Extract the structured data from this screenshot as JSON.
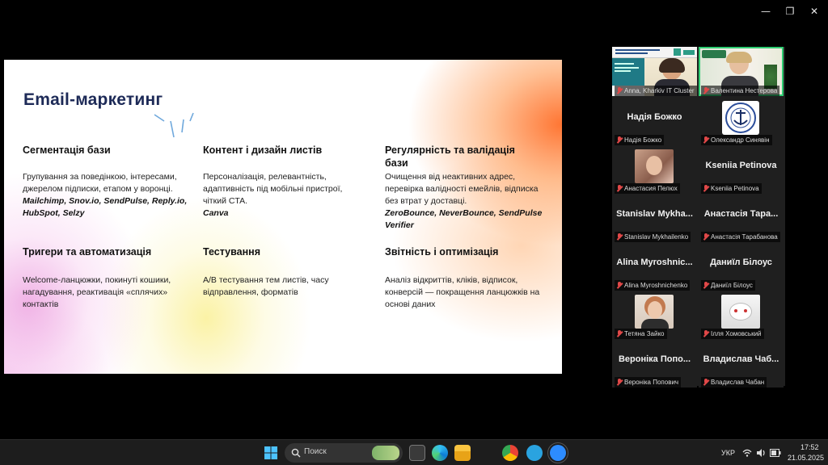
{
  "window": {
    "controls": {
      "minimize": "—",
      "restore": "❐",
      "close": "✕"
    }
  },
  "slide": {
    "title": "Email-маркетинг",
    "blocks": [
      {
        "title": "Сегментація бази",
        "body": "Групування за поведінкою, інтересами, джерелом підписки, етапом у воронці.",
        "tools": "Mailchimp, Snov.io, SendPulse, Reply.io, HubSpot, Selzy"
      },
      {
        "title": "Контент і дизайн листів",
        "body": "Персоналізація, релевантність, адаптивність під мобільні пристрої, чіткий CTA.",
        "tools": "Canva"
      },
      {
        "title": "Регулярність та валідація бази",
        "body": "Очищення від неактивних адрес, перевірка валідності емейлів, відписка без втрат у доставці.",
        "tools": "ZeroBounce, NeverBounce, SendPulse Verifier"
      },
      {
        "title": "Тригери та автоматизація",
        "body": "Welcome-ланцюжки, покинуті кошики, нагадування, реактивація «сплячих» контактів",
        "tools": ""
      },
      {
        "title": "Тестування",
        "body": "A/B тестування тем листів, часу відправлення, форматів",
        "tools": ""
      },
      {
        "title": "Звітність і оптимізація",
        "body": "Аналіз відкриттів, кліків, відписок, конверсій — покращення ланцюжків на основі даних",
        "tools": ""
      }
    ]
  },
  "participants": {
    "video": [
      {
        "label": "Anna, Kharkiv IT Cluster"
      },
      {
        "label": "Валентина Нестерова"
      }
    ],
    "tiles": [
      {
        "name": "Надія Божко",
        "label": "Надія Божко",
        "kind": "name"
      },
      {
        "name": "",
        "label": "Олександр Синявін",
        "kind": "logo"
      },
      {
        "name": "",
        "label": "Анастасия Пелюх",
        "kind": "photo"
      },
      {
        "name": "Kseniia Petinova",
        "label": "Kseniia Petinova",
        "kind": "name"
      },
      {
        "name": "Stanislav Mykha...",
        "label": "Stanislav Mykhailenko",
        "kind": "name"
      },
      {
        "name": "Анастасія Тара...",
        "label": "Анастасія Тарабанова",
        "kind": "name"
      },
      {
        "name": "Alina Myroshnic...",
        "label": "Alina Myroshnichenko",
        "kind": "name"
      },
      {
        "name": "Даниїл Білоус",
        "label": "Даниїл Білоус",
        "kind": "name"
      },
      {
        "name": "",
        "label": "Тетяна Зайко",
        "kind": "photo"
      },
      {
        "name": "",
        "label": "Ілля Хомовський",
        "kind": "photo"
      },
      {
        "name": "Вероніка Попо...",
        "label": "Вероніка Попович",
        "kind": "name"
      },
      {
        "name": "Владислав Чаб...",
        "label": "Владислав Чабан",
        "kind": "name"
      }
    ]
  },
  "taskbar": {
    "search_placeholder": "Поиск",
    "language": "УКР",
    "time": "17:52",
    "date": "21.05.2025",
    "icons": [
      "windows-start-icon",
      "search-icon",
      "task-view-icon",
      "edge-icon",
      "file-explorer-icon",
      "chrome-icon",
      "telegram-icon",
      "zoom-icon"
    ]
  }
}
